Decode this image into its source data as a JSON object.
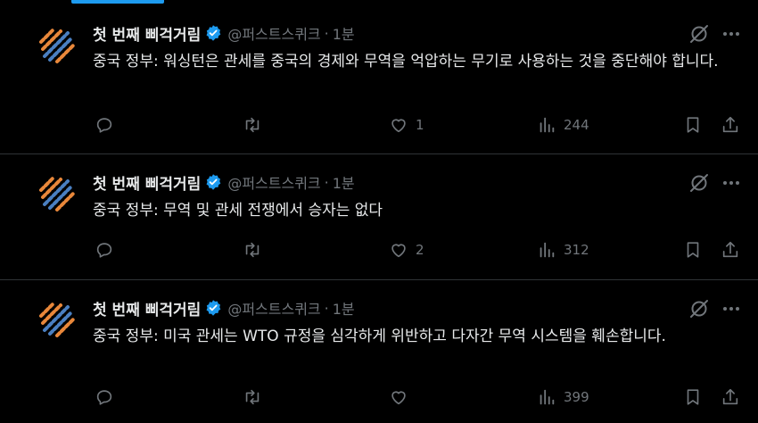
{
  "tweets": [
    {
      "author": "첫 번째 삐걱거림",
      "handle": "@퍼스트스퀴크",
      "separator": "·",
      "time": "1분",
      "text": "중국 정부: 워싱턴은 관세를 중국의 경제와 무역을 억압하는 무기로 사용하는 것을 중단해야 합니다.",
      "likes": "1",
      "views": "244"
    },
    {
      "author": "첫 번째 삐걱거림",
      "handle": "@퍼스트스퀴크",
      "separator": "·",
      "time": "1분",
      "text": "중국 정부: 무역 및 관세 전쟁에서 승자는 없다",
      "likes": "2",
      "views": "312"
    },
    {
      "author": "첫 번째 삐걱거림",
      "handle": "@퍼스트스퀴크",
      "separator": "·",
      "time": "1분",
      "text": "중국 정부: 미국 관세는 WTO 규정을 심각하게 위반하고 다자간 무역 시스템을 훼손합니다.",
      "likes": "",
      "views": "399"
    }
  ],
  "icons": {
    "avatar": "first-squawk-logo-icon",
    "verified": "verified-badge-icon",
    "grok": "grok-icon",
    "more": "more-icon",
    "reply": "reply-icon",
    "retweet": "retweet-icon",
    "like": "heart-icon",
    "views": "views-icon",
    "bookmark": "bookmark-icon",
    "share": "share-icon"
  },
  "colors": {
    "background": "#000000",
    "text": "#e7e9ea",
    "muted": "#71767b",
    "accent": "#1d9bf0",
    "logo_orange": "#e8873a",
    "logo_blue": "#4a7fc1"
  }
}
